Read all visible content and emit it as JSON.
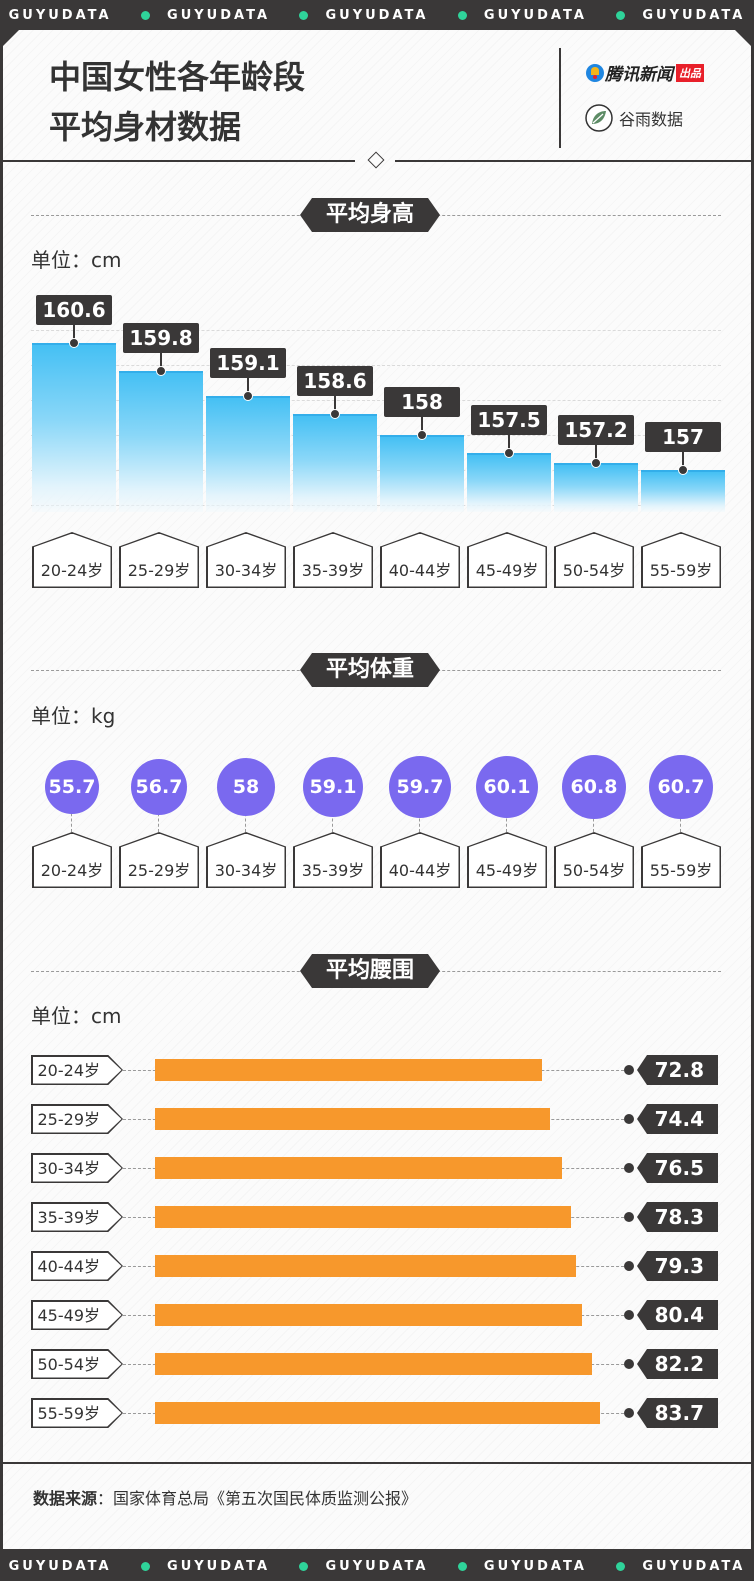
{
  "banner": [
    "GUYUDATA",
    "GUYUDATA",
    "GUYUDATA",
    "GUYUDATA",
    "GUYUDATA"
  ],
  "header": {
    "title_line1": "中国女性各年龄段",
    "title_line2": "平均身材数据",
    "brand1_name": "腾讯新闻",
    "brand1_tag": "出品",
    "brand2_name": "谷雨数据"
  },
  "chart_data": [
    {
      "type": "bar",
      "section_title": "平均身高",
      "unit_label": "单位：cm",
      "categories": [
        "20-24岁",
        "25-29岁",
        "30-34岁",
        "35-39岁",
        "40-44岁",
        "45-49岁",
        "50-54岁",
        "55-59岁"
      ],
      "values": [
        160.6,
        159.8,
        159.1,
        158.6,
        158,
        157.5,
        157.2,
        157
      ],
      "value_labels": [
        "160.6",
        "159.8",
        "159.1",
        "158.6",
        "158",
        "157.5",
        "157.2",
        "157"
      ],
      "colors": {
        "bar_top": "#45c0f4",
        "label_bg": "#3a3838"
      }
    },
    {
      "type": "scatter",
      "section_title": "平均体重",
      "unit_label": "单位：kg",
      "categories": [
        "20-24岁",
        "25-29岁",
        "30-34岁",
        "35-39岁",
        "40-44岁",
        "45-49岁",
        "50-54岁",
        "55-59岁"
      ],
      "values": [
        55.7,
        56.7,
        58,
        59.1,
        59.7,
        60.1,
        60.8,
        60.7
      ],
      "value_labels": [
        "55.7",
        "56.7",
        "58",
        "59.1",
        "59.7",
        "60.1",
        "60.8",
        "60.7"
      ],
      "colors": {
        "circle": "#7a69ef"
      }
    },
    {
      "type": "bar",
      "orientation": "horizontal",
      "section_title": "平均腰围",
      "unit_label": "单位：cm",
      "categories": [
        "20-24岁",
        "25-29岁",
        "30-34岁",
        "35-39岁",
        "40-44岁",
        "45-49岁",
        "50-54岁",
        "55-59岁"
      ],
      "values": [
        72.8,
        74.4,
        76.5,
        78.3,
        79.3,
        80.4,
        82.2,
        83.7
      ],
      "value_labels": [
        "72.8",
        "74.4",
        "76.5",
        "78.3",
        "79.3",
        "80.4",
        "82.2",
        "83.7"
      ],
      "colors": {
        "bar": "#f7982c"
      }
    }
  ],
  "footer": {
    "source_label": "数据来源",
    "source_text": "：国家体育总局《第五次国民体质监测公报》"
  }
}
